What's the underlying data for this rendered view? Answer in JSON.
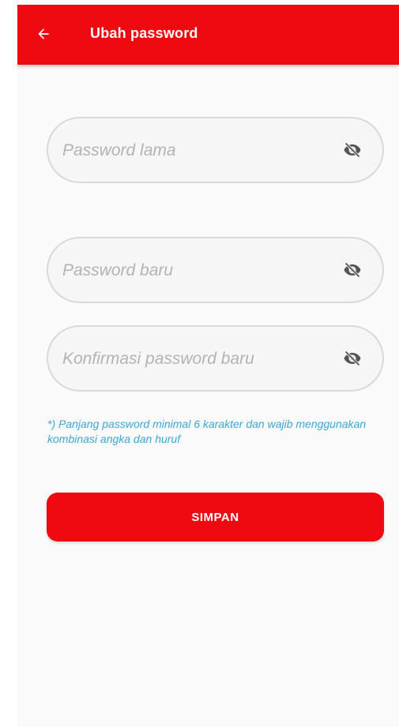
{
  "app_bar": {
    "title": "Ubah password",
    "back_icon": "arrow-left-icon"
  },
  "form": {
    "old_password": {
      "placeholder": "Password lama",
      "value": "",
      "toggle_icon": "eye-off-icon"
    },
    "new_password": {
      "placeholder": "Password baru",
      "value": "",
      "toggle_icon": "eye-off-icon"
    },
    "confirm_password": {
      "placeholder": "Konfirmasi password baru",
      "value": "",
      "toggle_icon": "eye-off-icon"
    },
    "hint": "*) Panjang password minimal 6 karakter dan wajib menggunakan kombinasi angka dan huruf",
    "save_label": "SIMPAN"
  },
  "colors": {
    "primary": "#ee0a10",
    "hint": "#3aa6d8",
    "field_border": "#d9d9d9",
    "background": "#fafafa"
  }
}
